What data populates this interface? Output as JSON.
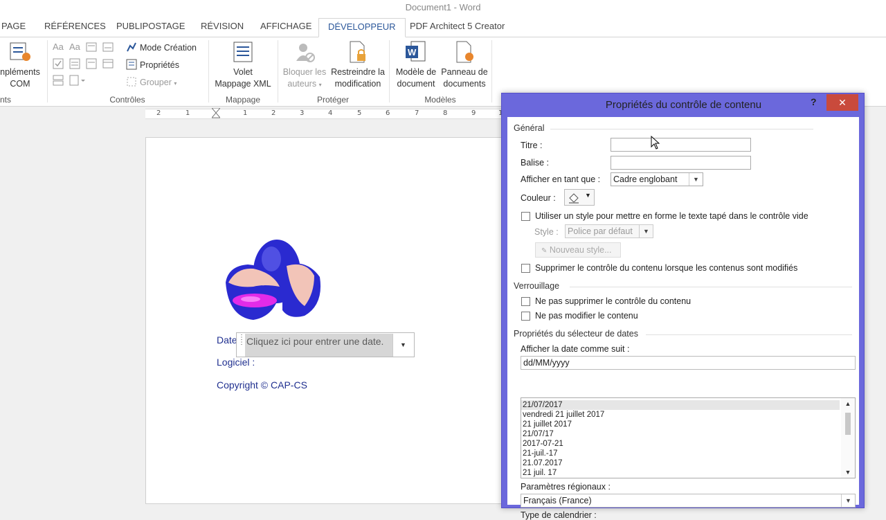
{
  "window": {
    "title": "Document1 - Word"
  },
  "tabs": [
    {
      "label": "PAGE"
    },
    {
      "label": "RÉFÉRENCES"
    },
    {
      "label": "PUBLIPOSTAGE"
    },
    {
      "label": "RÉVISION"
    },
    {
      "label": "AFFICHAGE"
    },
    {
      "label": "DÉVELOPPEUR"
    },
    {
      "label": "PDF Architect 5 Creator"
    }
  ],
  "ribbon": {
    "complements": {
      "line1": "npléments",
      "line2": "COM",
      "group": "nts"
    },
    "controls": {
      "mode_creation": "Mode Création",
      "proprietes": "Propriétés",
      "grouper": "Grouper",
      "group": "Contrôles"
    },
    "mapping": {
      "line1": "Volet",
      "line2": "Mappage XML",
      "group": "Mappage"
    },
    "protect": {
      "block_line1": "Bloquer les",
      "block_line2": "auteurs",
      "restrict_line1": "Restreindre la",
      "restrict_line2": "modification",
      "group": "Protéger"
    },
    "templates": {
      "model_line1": "Modèle de",
      "model_line2": "document",
      "panel_line1": "Panneau de",
      "panel_line2": "documents",
      "group": "Modèles"
    }
  },
  "ruler": {
    "labels": [
      "2",
      "1",
      "1",
      "1",
      "2",
      "3",
      "4",
      "5",
      "6",
      "7",
      "8",
      "9",
      "1"
    ]
  },
  "document": {
    "date_label": "Date",
    "date_placeholder": "Cliquez ici pour entrer une date.",
    "logiciel_label": "Logiciel :",
    "copyright": "Copyright © CAP-CS"
  },
  "dialog": {
    "title": "Propriétés du contrôle de contenu",
    "help": "?",
    "close": "✕",
    "general": {
      "header": "Général",
      "titre_label": "Titre :",
      "titre_value": "",
      "balise_label": "Balise :",
      "balise_value": "",
      "afficher_label": "Afficher en tant que :",
      "afficher_value": "Cadre englobant",
      "couleur_label": "Couleur :",
      "use_style_label": "Utiliser un style pour mettre en forme le texte tapé dans le contrôle vide",
      "style_label": "Style :",
      "style_value": "Police par défaut",
      "new_style_button": "Nouveau style...",
      "remove_label": "Supprimer le contrôle du contenu lorsque les contenus sont modifiés"
    },
    "locking": {
      "header": "Verrouillage",
      "no_delete": "Ne pas supprimer le contrôle du contenu",
      "no_edit": "Ne pas modifier le contenu"
    },
    "date_picker": {
      "header": "Propriétés du sélecteur de dates",
      "format_label": "Afficher la date comme suit :",
      "format_value": "dd/MM/yyyy",
      "formats": [
        "21/07/2017",
        "vendredi 21 juillet 2017",
        "21 juillet 2017",
        "21/07/17",
        "2017-07-21",
        "21-juil.-17",
        "21.07.2017",
        "21 juil. 17"
      ],
      "locale_label": "Paramètres régionaux :",
      "locale_value": "Français (France)",
      "calendar_label": "Type de calendrier :"
    }
  }
}
